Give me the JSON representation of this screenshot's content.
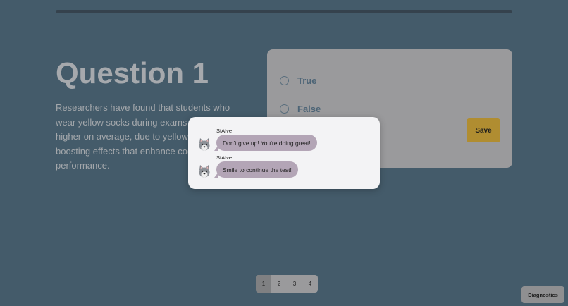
{
  "question": {
    "title": "Question 1",
    "text": "Researchers have found that students who wear yellow socks during exams score higher on average, due to yellow's mood-boosting effects that enhance cognitive performance."
  },
  "answers": {
    "options": [
      {
        "label": "True",
        "selected": false
      },
      {
        "label": "False",
        "selected": false
      }
    ],
    "save_label": "Save"
  },
  "chat": {
    "messages": [
      {
        "sender": "StAIve",
        "avatar_icon": "wolf-icon",
        "text": "Don't give up! You're doing great!"
      },
      {
        "sender": "StAIve",
        "avatar_icon": "wolf-icon",
        "text": "Smile to continue the test!"
      }
    ]
  },
  "pagination": {
    "pages": [
      "1",
      "2",
      "3",
      "4"
    ],
    "current": "1"
  },
  "diagnostics_label": "Diagnostics",
  "colors": {
    "background": "#445b6a",
    "save_button": "#b08d31",
    "bubble": "#b3a5b6",
    "popup": "#f3f3f5"
  }
}
